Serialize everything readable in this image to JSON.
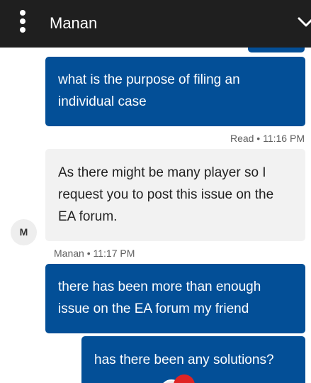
{
  "header": {
    "title": "Manan",
    "menu_icon": "kebab-menu-icon",
    "collapse_icon": "chevron-down-icon",
    "background": "#1f1f1f"
  },
  "conversation": {
    "messages": [
      {
        "direction": "outgoing",
        "text": "what is the purpose of filing an individual case"
      },
      {
        "direction": "incoming",
        "text": "As there might be many player so I request you to post this issue on the EA forum."
      },
      {
        "direction": "outgoing",
        "text": "there has been more than enough issue on the EA forum my friend"
      },
      {
        "direction": "outgoing",
        "text": "has there been any solutions?"
      }
    ],
    "read_receipt": "Read • 11:16 PM",
    "agent_meta": "Manan • 11:17 PM",
    "agent_avatar_initial": "M",
    "outgoing_color": "#034f97",
    "incoming_color": "#f2f2f2"
  }
}
